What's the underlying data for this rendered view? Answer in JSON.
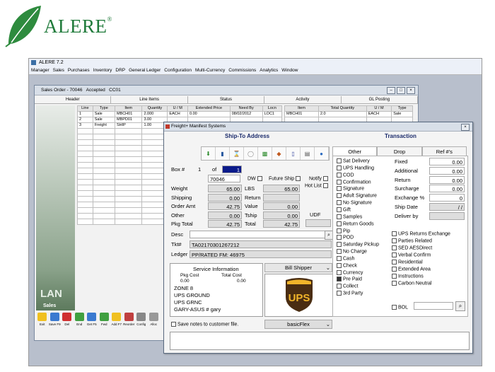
{
  "logo": {
    "text": "ALERE",
    "reg": "®",
    "leaf_color": "#2e8b3e"
  },
  "app": {
    "title": "ALERE 7.2",
    "menu": [
      "Manager",
      "Sales",
      "Purchases",
      "Inventory",
      "DRP",
      "General Ledger",
      "Configuration",
      "Multi-Currency",
      "Commissions",
      "Analytics",
      "Window"
    ]
  },
  "sales_order": {
    "title": "Sales Order - 70046",
    "status": "Accepted",
    "code": "CC01",
    "tabs": [
      "Header",
      "Line Items",
      "Status",
      "Activity",
      "GL Posting"
    ],
    "side_big": "LAN",
    "side_small": "Sales",
    "left_grid": {
      "headers": [
        "Line",
        "Type",
        "Item",
        "Quantity",
        "U / M",
        "Extended Price",
        "Need By",
        "Locn"
      ],
      "rows": [
        [
          "1",
          "Sale",
          "MBCH01",
          "2.000",
          "EACH",
          "0.00",
          "08/02/2012",
          "LOC1"
        ],
        [
          "2",
          "Sale",
          "MBPD01",
          "3.00",
          "",
          "",
          "",
          ""
        ],
        [
          "3",
          "Freight",
          "SHIP",
          "1.00",
          "",
          "",
          "",
          ""
        ]
      ]
    },
    "right_grid": {
      "headers": [
        "Item",
        "Total Quantity",
        "U / M",
        "Type"
      ],
      "rows": [
        [
          "MBCH01",
          "2.0",
          "EACH",
          "Sale"
        ]
      ]
    },
    "toolbar": [
      "Exit",
      "Save F9",
      "Del",
      "End",
      "Get F5",
      "Fwd",
      "Add F7",
      "Reorder",
      "Config",
      "Alloc"
    ]
  },
  "freight": {
    "title": "Freight+ Manifest Systems",
    "shipto_heading": "Ship-To Address",
    "transaction_heading": "Transaction",
    "box_label": "Box #",
    "box_num": "1",
    "of_label": "of",
    "box_total": "1",
    "order_no": "70046",
    "dw": "DW",
    "future_ship": "Future Ship",
    "notify": "Notify",
    "hot_list": "Hot List",
    "rows": [
      {
        "label": "Weight",
        "value": "65.00",
        "label2": "LBS",
        "value2": "65.00"
      },
      {
        "label": "Shipping",
        "value": "0.00",
        "label2": "Return",
        "value2": ""
      },
      {
        "label": "Order Amt",
        "value": "42.75",
        "label2": "Value",
        "value2": "0.00"
      },
      {
        "label": "Other",
        "value": "0.00",
        "label2": "Tship",
        "value2": "0.00"
      },
      {
        "label": "Pkg Total",
        "value": "42.75",
        "label2": "Total",
        "value2": "42.75"
      }
    ],
    "udf": "UDF",
    "desc_label": "Desc",
    "tkt_label": "Tkt#",
    "tkt_value": "TA02170301267212",
    "ledger_label": "Ledger",
    "ledger_value": "PP/RATED FM: 46975",
    "service": {
      "heading": "Service Information",
      "pkg_cost_label": "Pkg Cost",
      "total_cost_label": "Total Cost",
      "pkg_cost": "0.00",
      "total_cost": "0.00",
      "lines": [
        "ZONE 8",
        "UPS GROUND",
        "UPS GRNC",
        "GARY-ASUS # gary"
      ]
    },
    "bill": "Bill Shipper",
    "carrier_logo": "UPS",
    "save_notes": "Save notes to customer file.",
    "flex": "basicFlex",
    "tabs": [
      "Other",
      "Drop",
      "Ref #'s"
    ],
    "options_left": [
      {
        "label": "Sat Delivery",
        "checked": false
      },
      {
        "label": "UPS Handling",
        "checked": false
      },
      {
        "label": "COD",
        "checked": false
      },
      {
        "label": "Confirmation",
        "checked": false
      },
      {
        "label": "Signature",
        "checked": false
      },
      {
        "label": "Adult Signature",
        "checked": false
      },
      {
        "label": "No Signature",
        "checked": false
      },
      {
        "label": "Gift",
        "checked": false
      },
      {
        "label": "Samples",
        "checked": false
      },
      {
        "label": "Return Goods",
        "checked": false
      },
      {
        "label": "Pip",
        "checked": false
      },
      {
        "label": "POD",
        "checked": false
      },
      {
        "label": "Saturday Pickup",
        "checked": false
      },
      {
        "label": "No Charge",
        "checked": false
      },
      {
        "label": "Cash",
        "checked": false
      },
      {
        "label": "Check",
        "checked": false
      },
      {
        "label": "Currency",
        "checked": false
      },
      {
        "label": "Pre Paid",
        "checked": true
      },
      {
        "label": "Collect",
        "checked": false
      },
      {
        "label": "3rd Party",
        "checked": false
      }
    ],
    "options_right": [
      {
        "label": "UPS Returns Exchange",
        "checked": false
      },
      {
        "label": "Parties Related",
        "checked": false
      },
      {
        "label": "SED AESDirect",
        "checked": false
      },
      {
        "label": "Verbal Confirm",
        "checked": false
      },
      {
        "label": "Residential",
        "checked": false
      },
      {
        "label": "Extended Area",
        "checked": false
      },
      {
        "label": "Instructions",
        "checked": false
      },
      {
        "label": "Carbon Neutral",
        "checked": false
      }
    ],
    "charges": [
      {
        "label": "Fixed",
        "value": "0.00"
      },
      {
        "label": "Additional",
        "value": "0.00"
      },
      {
        "label": "Return",
        "value": "0.00"
      },
      {
        "label": "Surcharge",
        "value": "0.00"
      },
      {
        "label": "Exchange %",
        "value": "0"
      },
      {
        "label": "Ship Date",
        "value": "/ /"
      },
      {
        "label": "Deliver by",
        "value": ""
      }
    ],
    "bol": "BOL"
  }
}
